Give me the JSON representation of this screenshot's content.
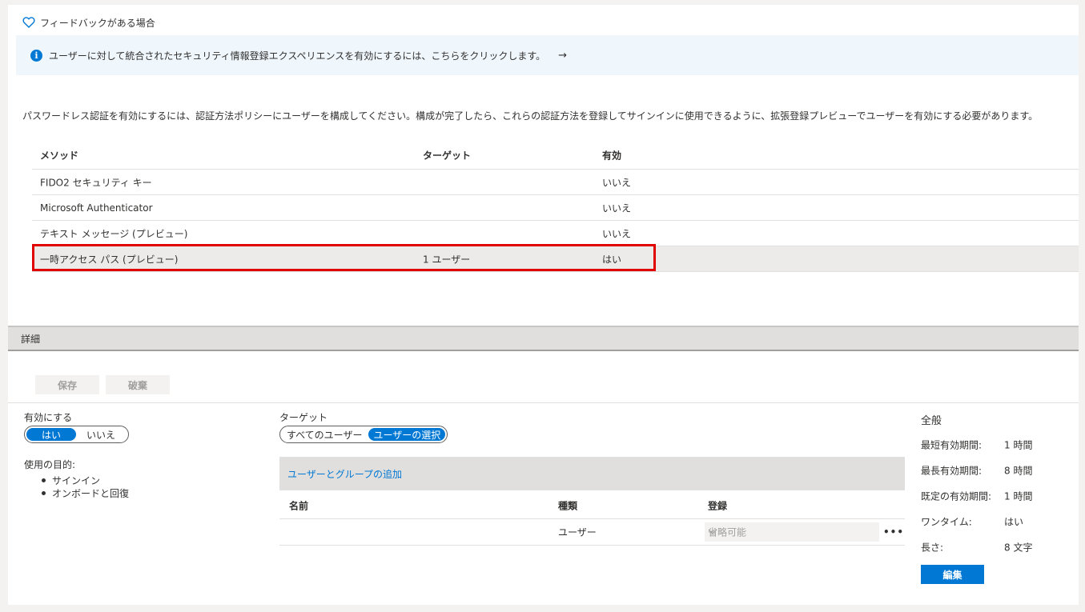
{
  "feedback": {
    "label": "フィードバックがある場合"
  },
  "info_bar": {
    "text": "ユーザーに対して統合されたセキュリティ情報登録エクスペリエンスを有効にするには、こちらをクリックします。",
    "arrow": "→"
  },
  "description": "パスワードレス認証を有効にするには、認証方法ポリシーにユーザーを構成してください。構成が完了したら、これらの認証方法を登録してサインインに使用できるように、拡張登録プレビューでユーザーを有効にする必要があります。",
  "methods_table": {
    "headers": [
      "メソッド",
      "ターゲット",
      "有効"
    ],
    "rows": [
      {
        "method": "FIDO2 セキュリティ キー",
        "target": "",
        "enabled": "いいえ"
      },
      {
        "method": "Microsoft Authenticator",
        "target": "",
        "enabled": "いいえ"
      },
      {
        "method": "テキスト メッセージ (プレビュー)",
        "target": "",
        "enabled": "いいえ"
      },
      {
        "method": "一時アクセス パス (プレビュー)",
        "target": "1 ユーザー",
        "enabled": "はい"
      }
    ]
  },
  "details": {
    "title": "詳細",
    "save_label": "保存",
    "discard_label": "破棄",
    "enable_label": "有効にする",
    "enable_options": [
      "はい",
      "いいえ"
    ],
    "purpose_label": "使用の目的:",
    "purposes": [
      "サインイン",
      "オンボードと回復"
    ],
    "target_label": "ターゲット",
    "target_options": [
      "すべてのユーザー",
      "ユーザーの選択"
    ],
    "add_link": "ユーザーとグループの追加",
    "target_table": {
      "headers": [
        "名前",
        "種類",
        "登録"
      ],
      "rows": [
        {
          "name": "",
          "type": "ユーザー",
          "registration": "省略可能"
        }
      ]
    },
    "more_label": "•••",
    "general": {
      "title": "全般",
      "rows": [
        {
          "key": "最短有効期間:",
          "value": "1 時間"
        },
        {
          "key": "最長有効期間:",
          "value": "8 時間"
        },
        {
          "key": "既定の有効期間:",
          "value": "1 時間"
        },
        {
          "key": "ワンタイム:",
          "value": "はい"
        },
        {
          "key": "長さ:",
          "value": "8 文字"
        }
      ],
      "edit_label": "編集"
    }
  },
  "colors": {
    "accent": "#0078d4",
    "highlight": "#e00000",
    "info_bg": "#eff6fc"
  },
  "icons": {
    "feedback": "heart-icon",
    "info": "info-icon",
    "dropdown": "chevron-down-icon",
    "more": "more-icon"
  }
}
